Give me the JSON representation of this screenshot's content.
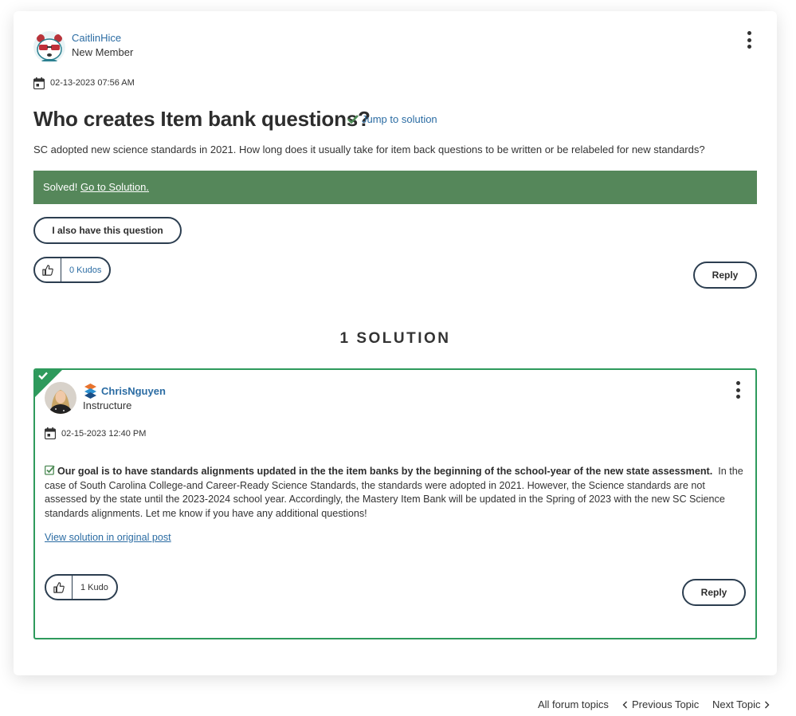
{
  "post": {
    "author": "CaitlinHice",
    "rank": "New Member",
    "date": "02-13-2023 07:56 AM",
    "title": "Who creates Item bank questions?",
    "jump_label": "Jump to solution",
    "body": "SC adopted new science standards in 2021. How long does it usually take for item back questions to be written or be relabeled for new standards?",
    "solved_prefix": "Solved!",
    "solved_link": "Go to Solution.",
    "also_have_label": "I also have this question",
    "kudos": "0 Kudos",
    "reply_label": "Reply"
  },
  "solution_heading": "1 SOLUTION",
  "solution": {
    "author": "ChrisNguyen",
    "rank": "Instructure",
    "date": "02-15-2023 12:40 PM",
    "bold_text": "Our goal is to have standards alignments updated in the the item banks by the beginning of the school-year of the new state assessment.",
    "text": "In the case of South Carolina College-and Career-Ready Science Standards, the standards were adopted in 2021. However, the Science standards are not assessed by the state until the 2023-2024 school year. Accordingly, the Mastery Item Bank will be updated in the Spring of 2023 with the new SC Science standards alignments. Let me know if you have any additional questions!",
    "view_link": "View solution in original post",
    "kudos": "1 Kudo",
    "reply_label": "Reply"
  },
  "footer": {
    "all_topics": "All forum topics",
    "previous": "Previous Topic",
    "next": "Next Topic"
  },
  "colors": {
    "link": "#2b6ca3",
    "solved_bar": "#55875a",
    "solution_border": "#2e9a5c",
    "button_border": "#2c3e50"
  }
}
